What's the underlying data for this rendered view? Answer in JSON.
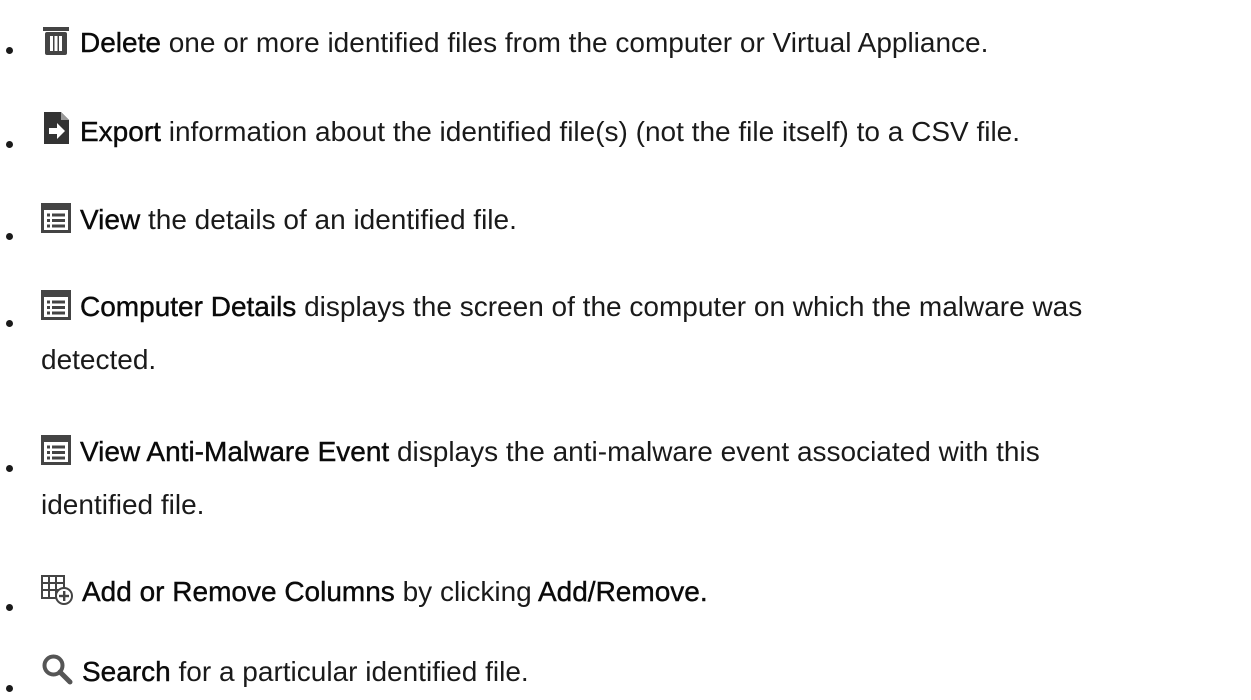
{
  "items": [
    {
      "icon": "trash-icon",
      "keyword": "Delete",
      "text": " one or more identified files from the computer or Virtual Appliance."
    },
    {
      "icon": "export-icon",
      "keyword": "Export",
      "text": " information about the identified file(s) (not the file itself) to a CSV file."
    },
    {
      "icon": "details-list-icon",
      "keyword": "View",
      "text": " the details of an identified file."
    },
    {
      "icon": "details-list-icon",
      "keyword": "Computer Details",
      "text": " displays the screen of the computer on which the malware was",
      "cont": "detected."
    },
    {
      "icon": "details-list-icon",
      "keyword": "View Anti-Malware Event",
      "text": " displays the anti-malware event associated with this",
      "cont": "identified file."
    },
    {
      "icon": "add-columns-icon",
      "keyword": "Add or Remove Columns",
      "text": " by clicking ",
      "keyword2": "Add/Remove."
    },
    {
      "icon": "search-icon",
      "keyword": "Search",
      "text": " for a particular identified file."
    }
  ]
}
